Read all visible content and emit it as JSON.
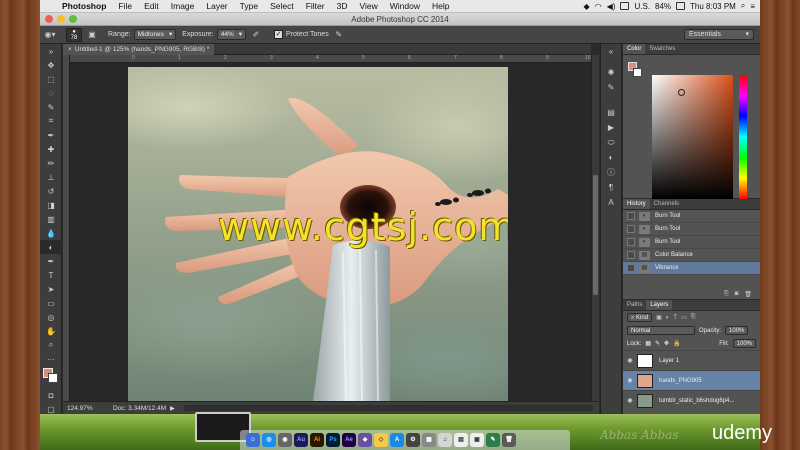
{
  "menubar": {
    "app": "Photoshop",
    "items": [
      "File",
      "Edit",
      "Image",
      "Layer",
      "Type",
      "Select",
      "Filter",
      "3D",
      "View",
      "Window",
      "Help"
    ],
    "status": {
      "input": "U.S.",
      "battery": "84%",
      "clock": "Thu 8:03 PM"
    }
  },
  "window": {
    "title": "Adobe Photoshop CC 2014"
  },
  "options": {
    "brush_size": "78",
    "range_label": "Range:",
    "range_value": "Midtones",
    "exposure_label": "Exposure:",
    "exposure_value": "44%",
    "protect_tones": "Protect Tones",
    "workspace": "Essentials"
  },
  "document": {
    "tab_title": "Untitled-1 @ 125% (hands_PNG905, RGB/8) *",
    "ruler_ticks": [
      "0",
      "1",
      "2",
      "3",
      "4",
      "5",
      "6",
      "7",
      "8",
      "9",
      "10"
    ],
    "watermark": "www.cgtsj.com"
  },
  "status": {
    "zoom": "124.97%",
    "doc": "Doc: 3.34M/12.4M"
  },
  "color_panel": {
    "tabs": [
      "Color",
      "Swatches"
    ],
    "fg_color": "#d98f7a",
    "bg_color": "#ffffff"
  },
  "history_panel": {
    "tabs": [
      "History",
      "Channels"
    ],
    "items": [
      "Burn Tool",
      "Burn Tool",
      "Burn Tool",
      "Color Balance",
      "Vibrance"
    ]
  },
  "layers_panel": {
    "tabs": [
      "Paths",
      "Layers"
    ],
    "kind_label": "Kind",
    "blend_mode": "Normal",
    "opacity_label": "Opacity:",
    "opacity_value": "100%",
    "lock_label": "Lock:",
    "fill_label": "Fill:",
    "fill_value": "100%",
    "layers": [
      "Layer 1",
      "hands_PNG905",
      "tumblr_static_b6shdog6p4..."
    ]
  },
  "branding": {
    "udemy": "udemy",
    "signature": "Abbas Abbas"
  }
}
